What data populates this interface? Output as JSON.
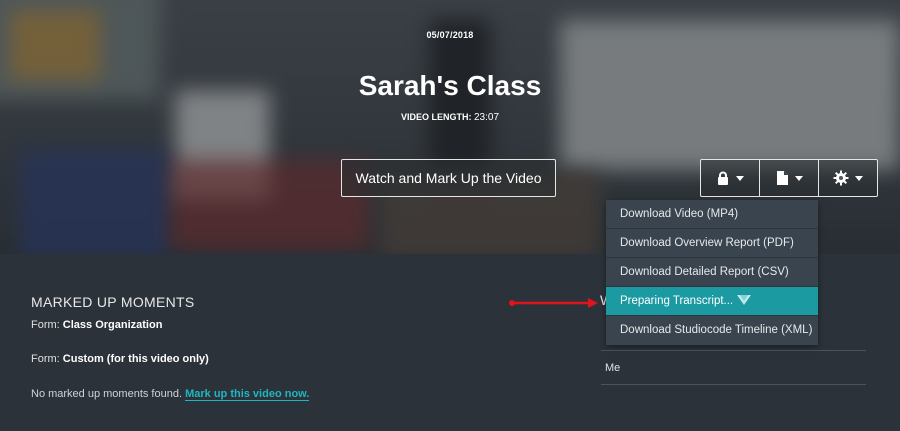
{
  "video": {
    "date": "05/07/2018",
    "title": "Sarah's Class",
    "length_label": "VIDEO LENGTH:",
    "length_value": "23:07"
  },
  "actions": {
    "watch_label": "Watch and Mark Up the Video",
    "privacy_icon": "lock-icon",
    "reports_icon": "document-icon",
    "settings_icon": "gear-icon"
  },
  "report_menu": {
    "items": [
      "Download Video (MP4)",
      "Download Overview Report (PDF)",
      "Download Detailed Report (CSV)",
      "Preparing Transcript...",
      "Download Studiocode Timeline (XML)"
    ],
    "highlighted_index": 3
  },
  "moments": {
    "heading": "MARKED UP MOMENTS",
    "form_prefix": "Form: ",
    "forms": [
      "Class Organization",
      "Custom (for this video only)"
    ],
    "empty_text": "No marked up moments found.",
    "empty_link": "Mark up this video now."
  },
  "viewers": {
    "heading_fragment": "W",
    "entries": [
      "Me"
    ]
  },
  "colors": {
    "accent": "#1b9aa2",
    "link": "#20b6bf",
    "background": "#2b323a",
    "annotation_arrow": "#e0141c"
  }
}
